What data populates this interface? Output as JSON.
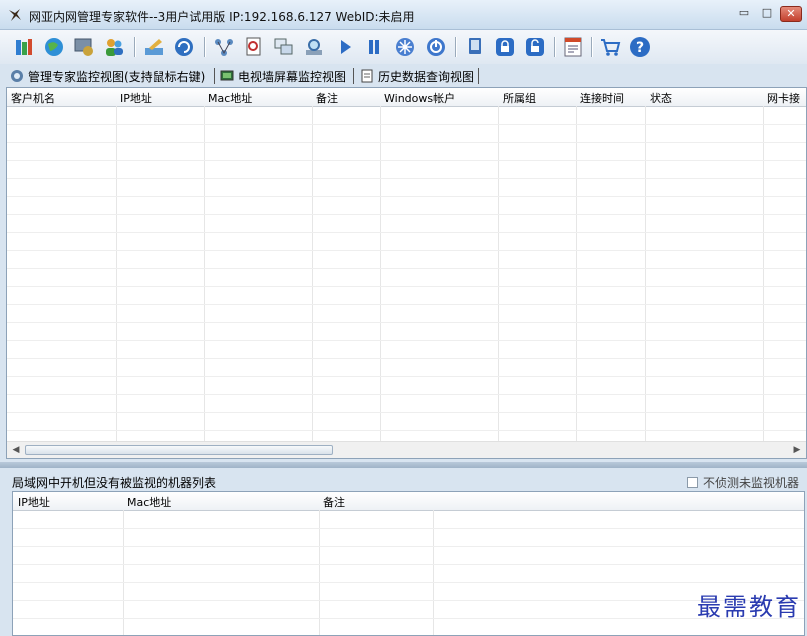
{
  "window": {
    "title": "网亚内网管理专家软件--3用户试用版 IP:192.168.6.127 WebID:未启用",
    "buttons": {
      "minimize": "▭",
      "maximize": "□",
      "close": "✕"
    }
  },
  "toolbar": {
    "icons": [
      "books-icon",
      "globe-icon",
      "monitor-settings-icon",
      "people-icon",
      "edit-icon",
      "refresh-icon",
      "network-icon",
      "document-search-icon",
      "windows-icon",
      "search-icon",
      "play-icon",
      "pause-icon",
      "snowflake-icon",
      "power-icon",
      "device-icon",
      "lock-icon",
      "unlock-icon",
      "report-icon",
      "cart-icon",
      "help-icon"
    ]
  },
  "tabs": [
    {
      "label": "管理专家监控视图(支持鼠标右键)",
      "icon": "monitor-view-icon"
    },
    {
      "label": "电视墙屏幕监控视图",
      "icon": "screen-wall-icon"
    },
    {
      "label": "历史数据查询视图",
      "icon": "history-icon"
    }
  ],
  "monitor_table": {
    "columns": [
      "客户机名",
      "IP地址",
      "Mac地址",
      "备注",
      "Windows帐户",
      "所属组",
      "连接时间",
      "状态",
      "网卡接"
    ],
    "rows": []
  },
  "lan_panel": {
    "title": "局域网中开机但没有被监视的机器列表",
    "checkbox_label": "不侦测未监视机器",
    "checkbox_checked": false,
    "columns": [
      "IP地址",
      "Mac地址",
      "备注"
    ],
    "rows": []
  },
  "watermark": "最需教育"
}
